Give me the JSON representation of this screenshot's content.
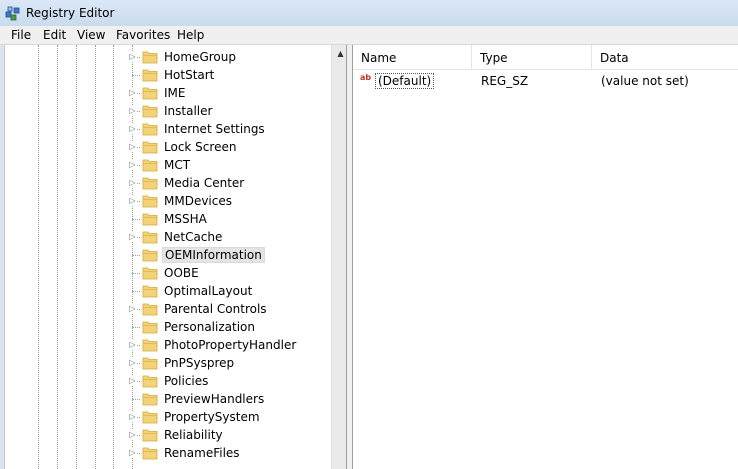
{
  "window": {
    "title": "Registry Editor"
  },
  "menu": [
    "File",
    "Edit",
    "View",
    "Favorites",
    "Help"
  ],
  "tree": {
    "keys": [
      {
        "label": "HomeGroup",
        "expandable": true
      },
      {
        "label": "HotStart",
        "expandable": false
      },
      {
        "label": "IME",
        "expandable": true
      },
      {
        "label": "Installer",
        "expandable": true
      },
      {
        "label": "Internet Settings",
        "expandable": true
      },
      {
        "label": "Lock Screen",
        "expandable": true
      },
      {
        "label": "MCT",
        "expandable": true
      },
      {
        "label": "Media Center",
        "expandable": true
      },
      {
        "label": "MMDevices",
        "expandable": true
      },
      {
        "label": "MSSHA",
        "expandable": false
      },
      {
        "label": "NetCache",
        "expandable": true
      },
      {
        "label": "OEMInformation",
        "expandable": false,
        "selected": true
      },
      {
        "label": "OOBE",
        "expandable": false
      },
      {
        "label": "OptimalLayout",
        "expandable": false
      },
      {
        "label": "Parental Controls",
        "expandable": true
      },
      {
        "label": "Personalization",
        "expandable": false
      },
      {
        "label": "PhotoPropertyHandler",
        "expandable": true
      },
      {
        "label": "PnPSysprep",
        "expandable": true
      },
      {
        "label": "Policies",
        "expandable": true
      },
      {
        "label": "PreviewHandlers",
        "expandable": false
      },
      {
        "label": "PropertySystem",
        "expandable": true
      },
      {
        "label": "Reliability",
        "expandable": true
      },
      {
        "label": "RenameFiles",
        "expandable": true
      }
    ]
  },
  "values": {
    "columns": [
      "Name",
      "Type",
      "Data"
    ],
    "rows": [
      {
        "name": "(Default)",
        "type": "REG_SZ",
        "data": "(value not set)",
        "icon": "string-value-icon",
        "icon_glyph": "ab"
      }
    ]
  },
  "colors": {
    "folder": "#f3d37a",
    "folder_dark": "#d9a93a",
    "selection": "#e4e4e4",
    "value_icon": "#c0342c"
  }
}
